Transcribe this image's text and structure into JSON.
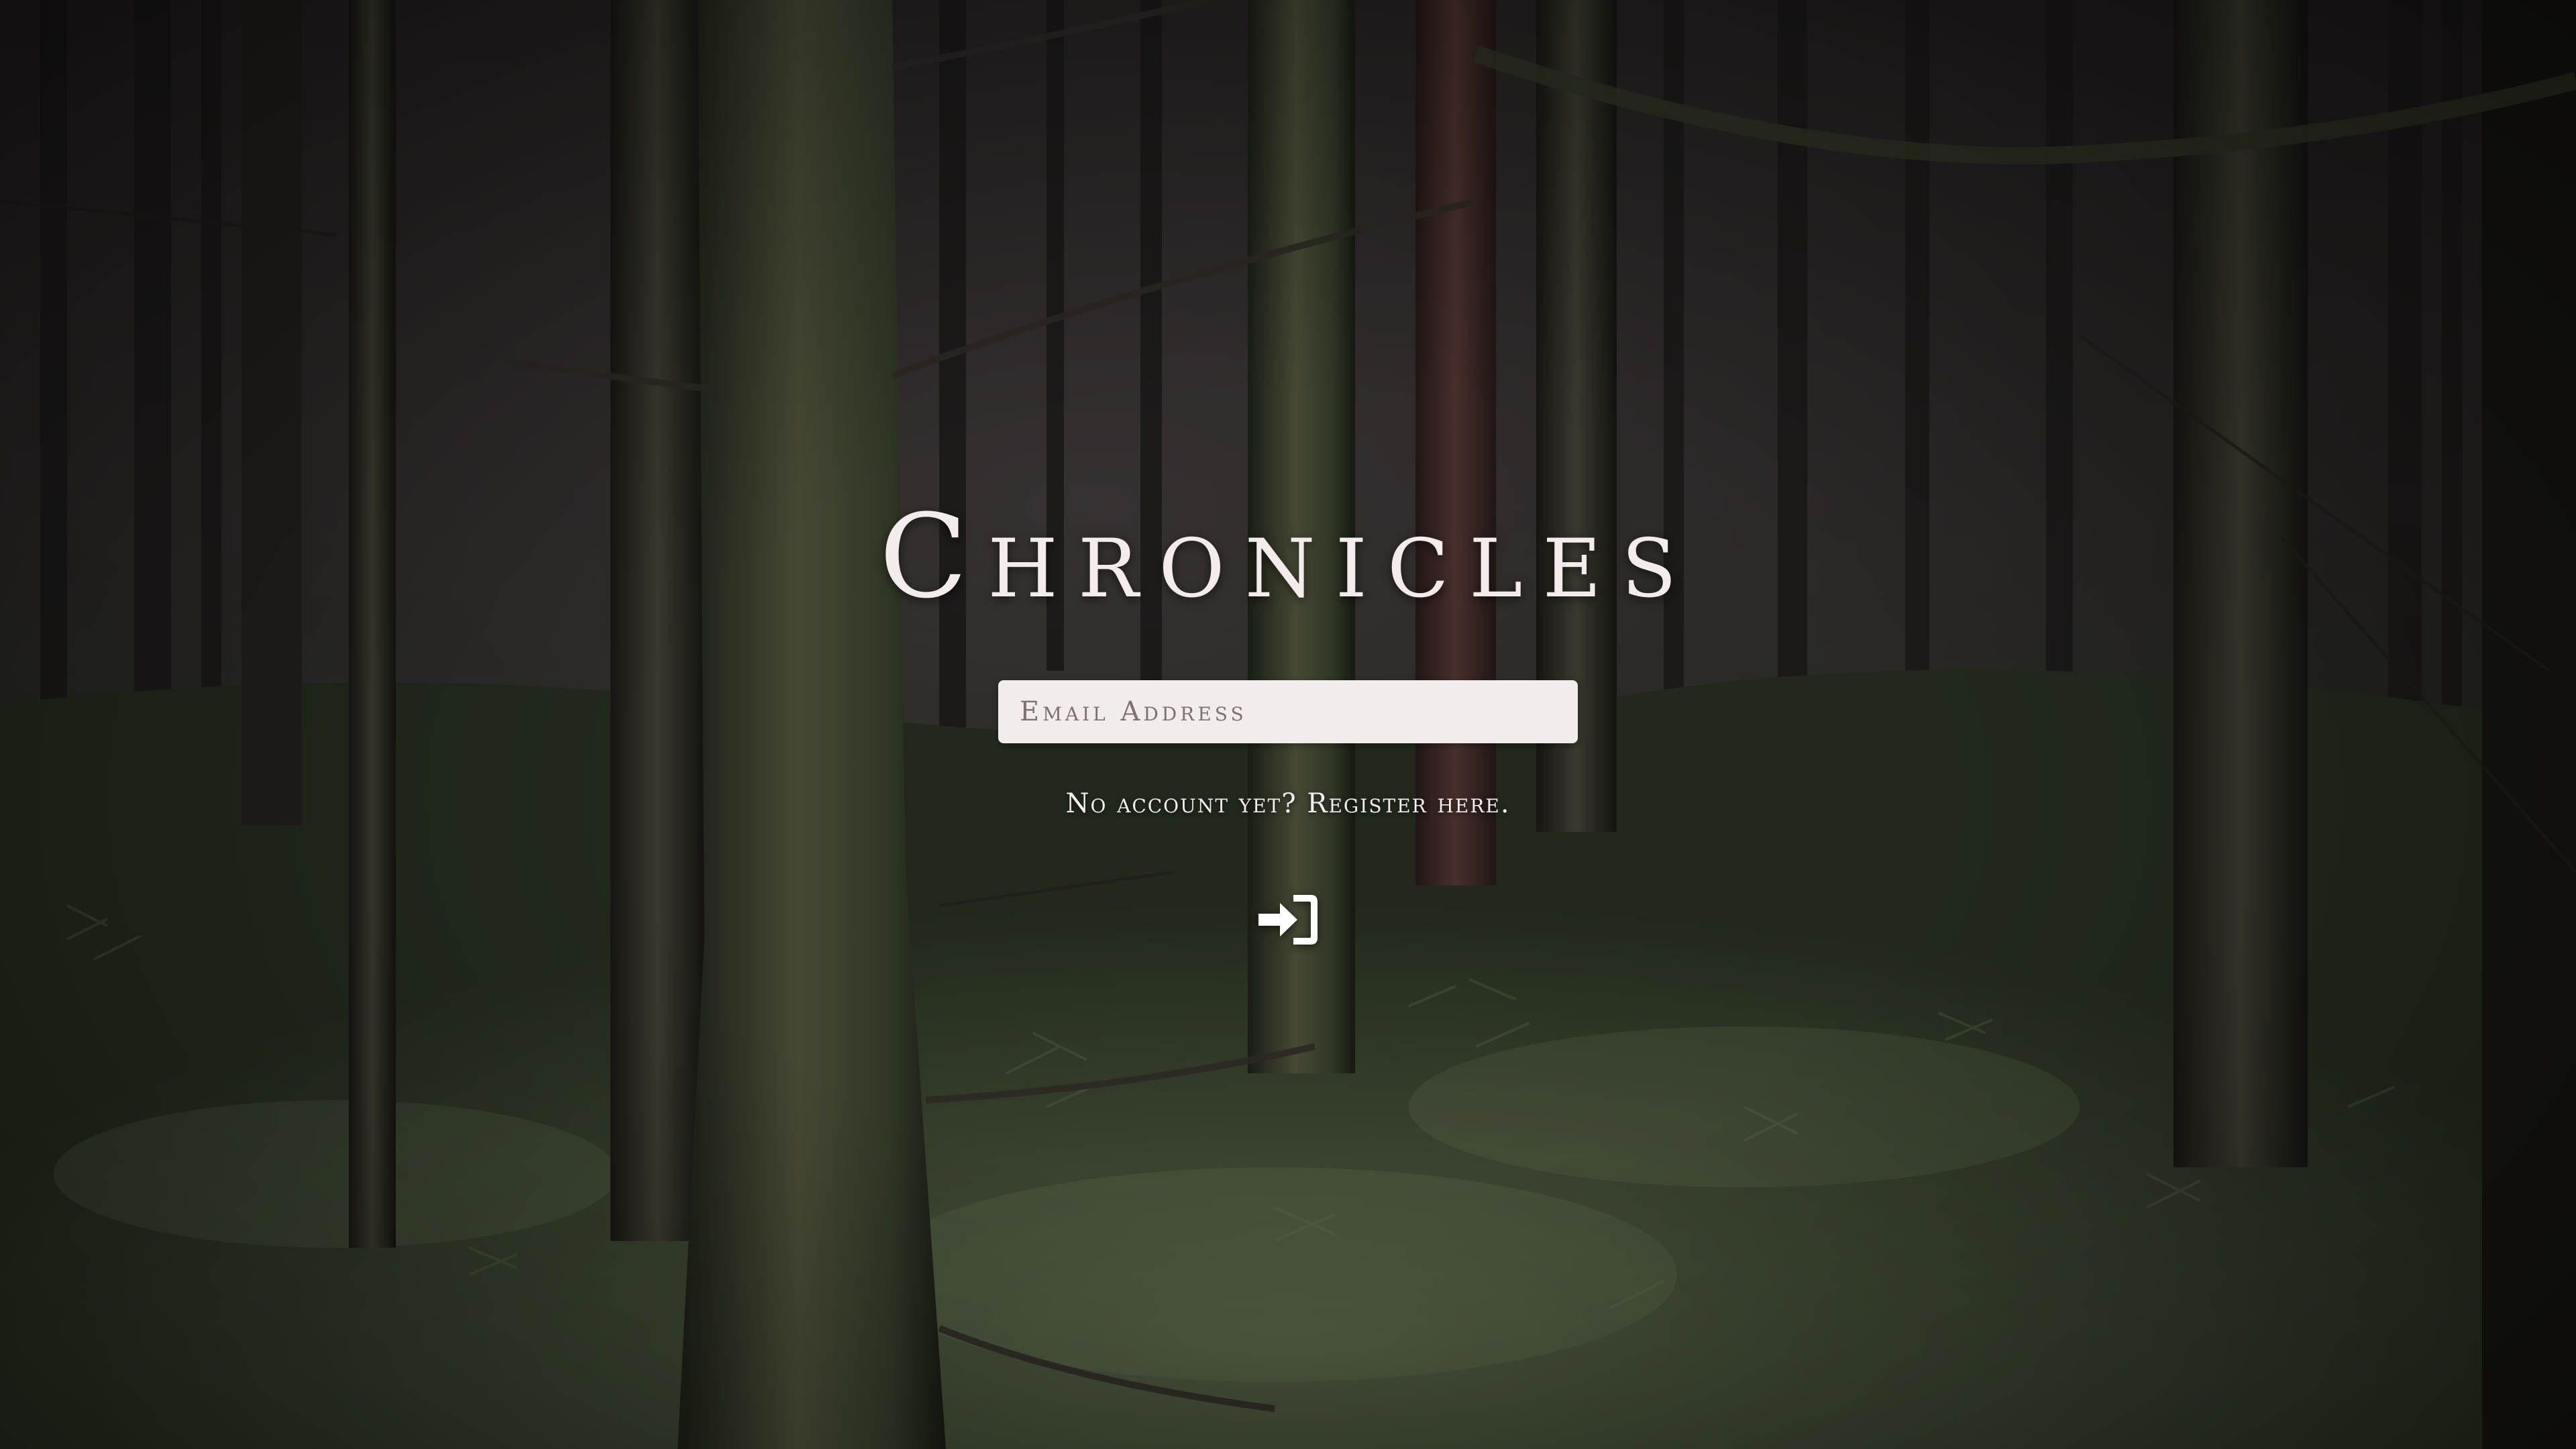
{
  "app": {
    "title": "Chronicles"
  },
  "login": {
    "email_placeholder": "Email Address",
    "email_value": "",
    "register_text": "No account yet? Register here.",
    "submit_icon": "sign-in-icon"
  },
  "background": {
    "description_icon": "forest-background"
  },
  "colors": {
    "title": "#f4ecec",
    "input_background": "#f3ecec",
    "text_light": "#f3eeee"
  }
}
